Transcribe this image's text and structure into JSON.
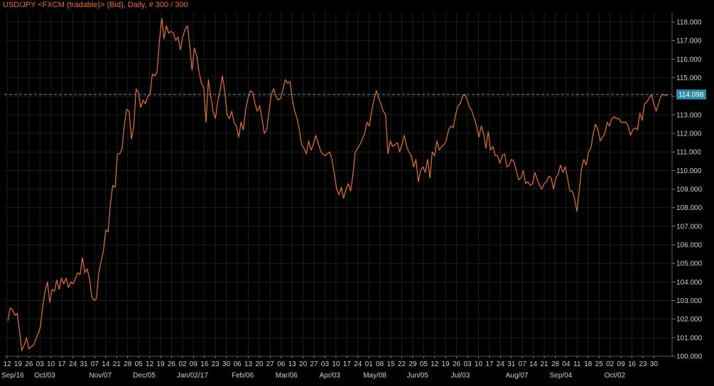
{
  "chart_title": "USD/JPY <FXCM (tradable)> (Bid), Daily, # 300 / 300",
  "colors": {
    "background": "#000000",
    "grid": "#1e1e1e",
    "axis_text": "#cfcfcf",
    "line": "#e8702a",
    "title": "#e8702a",
    "last_price_line": "#3aa0b8",
    "last_price_badge": "#2e8aa4"
  },
  "chart_data": {
    "type": "line",
    "title": "USD/JPY <FXCM (tradable)> (Bid), Daily, # 300 / 300",
    "ylim": [
      100.0,
      118.5
    ],
    "y_ticks": [
      "118.000",
      "117.000",
      "116.000",
      "115.000",
      "114.000",
      "113.000",
      "112.000",
      "111.000",
      "110.000",
      "109.000",
      "108.000",
      "107.000",
      "106.000",
      "105.000",
      "104.000",
      "103.000",
      "102.000",
      "101.000",
      "100.000"
    ],
    "last_price": "114.098",
    "x_day_ticks": [
      "12",
      "19",
      "26",
      "03",
      "10",
      "17",
      "24",
      "31",
      "07",
      "14",
      "21",
      "28",
      "05",
      "12",
      "19",
      "26",
      "02",
      "09",
      "16",
      "23",
      "30",
      "06",
      "13",
      "20",
      "27",
      "06",
      "13",
      "20",
      "27",
      "03",
      "10",
      "17",
      "24",
      "01",
      "08",
      "15",
      "22",
      "29",
      "05",
      "12",
      "19",
      "26",
      "03",
      "10",
      "17",
      "24",
      "31",
      "07",
      "14",
      "21",
      "28",
      "04",
      "11",
      "18",
      "25",
      "02",
      "09",
      "16",
      "23",
      "30"
    ],
    "x_month_labels": [
      "Sep/16",
      "Oct/03",
      "Nov/07",
      "Dec/05",
      "Jan/02/17",
      "Feb/06",
      "Mar/06",
      "Apr/03",
      "May/08",
      "Jun/05",
      "Jul/03",
      "Aug/07",
      "Sep/04",
      "Oct/02"
    ],
    "x_month_label_day_index": [
      0,
      3,
      8,
      12,
      16,
      21,
      25,
      29,
      33,
      37,
      41,
      46,
      50,
      55
    ],
    "series": [
      {
        "x_bar_index": [
          0,
          1,
          2,
          3,
          4,
          5,
          6,
          7,
          8,
          9,
          10,
          11,
          12,
          13,
          14,
          15,
          16,
          17,
          18,
          19,
          20,
          21,
          22,
          23,
          24,
          25,
          26,
          27,
          28,
          29,
          30,
          31,
          32,
          33,
          34,
          35,
          36,
          37,
          38,
          39,
          40,
          41,
          42,
          43,
          44,
          45,
          46,
          47,
          48,
          49,
          50,
          51,
          52,
          53,
          54,
          55,
          56,
          57,
          58,
          59,
          60,
          61,
          62,
          63,
          64,
          65,
          66,
          67,
          68,
          69,
          70,
          71,
          72,
          73,
          74,
          75,
          76,
          77,
          78,
          79,
          80,
          81,
          82,
          83,
          84,
          85,
          86,
          87,
          88,
          89,
          90,
          91,
          92,
          93,
          94,
          95,
          96,
          97,
          98,
          99,
          100,
          101,
          102,
          103,
          104,
          105,
          106,
          107,
          108,
          109,
          110,
          111,
          112,
          113,
          114,
          115,
          116,
          117,
          118,
          119,
          120,
          121,
          122,
          123,
          124,
          125,
          126,
          127,
          128,
          129,
          130,
          131,
          132,
          133,
          134,
          135,
          136,
          137,
          138,
          139,
          140,
          141,
          142,
          143,
          144,
          145,
          146,
          147,
          148,
          149,
          150,
          151,
          152,
          153,
          154,
          155,
          156,
          157,
          158,
          159,
          160,
          161,
          162,
          163,
          164,
          165,
          166,
          167,
          168,
          169,
          170,
          171,
          172,
          173,
          174,
          175,
          176,
          177,
          178,
          179,
          180,
          181,
          182,
          183,
          184,
          185,
          186,
          187,
          188,
          189,
          190,
          191,
          192,
          193,
          194,
          195,
          196,
          197,
          198,
          199,
          200,
          201,
          202,
          203,
          204,
          205,
          206,
          207,
          208,
          209,
          210,
          211,
          212,
          213,
          214,
          215,
          216,
          217,
          218,
          219,
          220,
          221,
          222,
          223,
          224,
          225,
          226,
          227,
          228,
          229,
          230,
          231,
          232,
          233,
          234,
          235,
          236,
          237,
          238,
          239,
          240,
          241,
          242,
          243,
          244,
          245,
          246,
          247,
          248,
          249,
          250,
          251,
          252,
          253,
          254,
          255,
          256,
          257,
          258,
          259,
          260,
          261,
          262,
          263,
          264,
          265,
          266,
          267,
          268,
          269,
          270,
          271,
          272,
          273,
          274,
          275,
          276,
          277,
          278,
          279,
          280,
          281,
          282,
          283,
          284,
          285,
          286,
          287,
          288,
          289,
          290,
          291,
          292,
          293,
          294,
          295,
          296,
          297,
          298,
          299
        ],
        "values": [
          101.9,
          102.6,
          102.5,
          102.2,
          102.3,
          101.4,
          100.3,
          100.6,
          101.0,
          100.4,
          100.5,
          100.6,
          100.9,
          101.2,
          101.6,
          102.7,
          103.5,
          104.0,
          102.9,
          103.6,
          103.5,
          104.1,
          103.6,
          104.2,
          103.9,
          104.2,
          103.7,
          104.0,
          103.9,
          104.2,
          104.5,
          104.4,
          105.3,
          104.5,
          104.7,
          104.2,
          103.2,
          103.0,
          103.1,
          104.5,
          105.1,
          105.7,
          106.8,
          106.7,
          108.2,
          109.2,
          109.1,
          110.9,
          110.9,
          111.2,
          112.5,
          113.3,
          113.2,
          111.7,
          112.4,
          114.4,
          114.2,
          113.4,
          113.8,
          113.6,
          114.0,
          114.1,
          115.2,
          115.1,
          115.3,
          117.0,
          118.2,
          117.1,
          117.8,
          117.4,
          117.5,
          117.4,
          117.0,
          117.2,
          116.5,
          117.2,
          117.6,
          117.8,
          116.8,
          115.4,
          116.6,
          116.2,
          115.3,
          114.7,
          114.5,
          112.6,
          114.9,
          114.0,
          113.2,
          112.8,
          113.7,
          114.3,
          115.1,
          114.3,
          113.0,
          112.8,
          113.2,
          112.6,
          112.4,
          111.8,
          112.6,
          112.2,
          113.3,
          113.9,
          114.3,
          114.2,
          113.6,
          113.2,
          113.5,
          112.8,
          112.0,
          112.2,
          113.2,
          114.1,
          114.4,
          114.0,
          113.8,
          113.9,
          114.4,
          114.9,
          114.7,
          114.8,
          113.8,
          113.2,
          112.8,
          112.2,
          111.4,
          111.2,
          110.9,
          111.6,
          111.1,
          111.4,
          111.9,
          111.5,
          111.1,
          110.9,
          110.8,
          110.9,
          111.0,
          110.6,
          109.8,
          109.0,
          108.7,
          109.1,
          108.5,
          109.0,
          109.3,
          108.9,
          109.8,
          111.0,
          111.2,
          111.4,
          111.7,
          112.0,
          112.6,
          112.4,
          113.2,
          113.8,
          114.3,
          113.9,
          113.6,
          113.2,
          113.0,
          110.9,
          111.6,
          111.3,
          111.4,
          111.5,
          111.0,
          111.4,
          111.9,
          111.3,
          111.0,
          110.8,
          110.2,
          110.6,
          109.4,
          110.0,
          110.2,
          109.9,
          110.6,
          109.6,
          111.0,
          110.8,
          111.6,
          111.1,
          111.3,
          111.4,
          111.6,
          112.2,
          112.4,
          112.3,
          113.0,
          113.5,
          113.6,
          114.0,
          114.1,
          113.8,
          113.4,
          113.2,
          112.8,
          112.4,
          111.8,
          112.4,
          112.0,
          111.2,
          112.1,
          111.1,
          111.3,
          110.8,
          110.8,
          110.4,
          110.8,
          110.9,
          110.2,
          110.3,
          110.6,
          110.5,
          110.0,
          109.5,
          109.6,
          110.0,
          109.3,
          109.4,
          109.2,
          109.3,
          109.9,
          109.5,
          109.2,
          109.0,
          109.3,
          109.4,
          109.7,
          109.6,
          109.0,
          109.6,
          109.8,
          110.3,
          109.9,
          110.2,
          109.6,
          108.9,
          108.9,
          108.5,
          107.8,
          108.9,
          110.1,
          110.6,
          110.3,
          111.0,
          111.2,
          112.0,
          112.5,
          112.2,
          111.6,
          111.8,
          112.0,
          112.6,
          112.4,
          112.8,
          112.9,
          112.8,
          112.8,
          112.6,
          112.6,
          112.6,
          112.4,
          111.9,
          112.2,
          112.3,
          112.2,
          113.1,
          112.7,
          113.6,
          113.7,
          113.9,
          114.1,
          113.6,
          113.2,
          113.6,
          114.0,
          114.1,
          114.05,
          114.098
        ]
      }
    ]
  }
}
